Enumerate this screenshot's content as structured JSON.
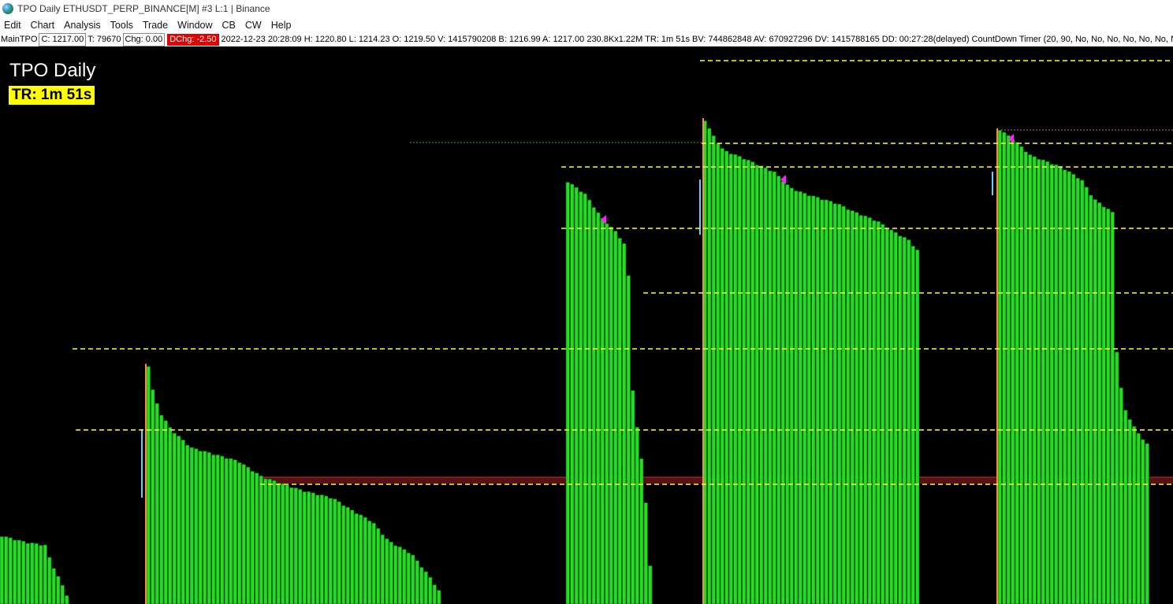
{
  "window": {
    "title": "TPO Daily ETHUSDT_PERP_BINANCE[M]  #3 L:1 | Binance",
    "icon": "globe-icon"
  },
  "menu": [
    "Edit",
    "Chart",
    "Analysis",
    "Tools",
    "Trade",
    "Window",
    "CB",
    "CW",
    "Help"
  ],
  "infobar": {
    "name": "MainTPO",
    "close": "C: 1217.00",
    "ticks": "T: 79670",
    "chg": "Chg: 0.00",
    "dchg": "DChg: -2.50",
    "rest": "2022-12-23 20:28:09 H: 1220.80 L: 1214.23 O: 1219.50 V: 1415790208 B: 1216.99 A: 1217.00 230.8Kx1.22M TR: 1m 51s BV: 744862848 AV: 670927296 DV: 1415788165 DD: 00:27:28(delayed) CountDown Timer   (20, 90, No, No, No, No, No, No, No"
  },
  "chart": {
    "title": "TPO Daily",
    "timer_label": "TR: 1m 51s",
    "colors": {
      "background": "#000000",
      "bar": "#22dd22",
      "bar_edge": "#0a6a0a",
      "level_line": "#ffff33",
      "marker": "#ff22ff",
      "open_line": "#ff8844",
      "band": "#5a1010",
      "tick": "#66ccff"
    }
  }
}
